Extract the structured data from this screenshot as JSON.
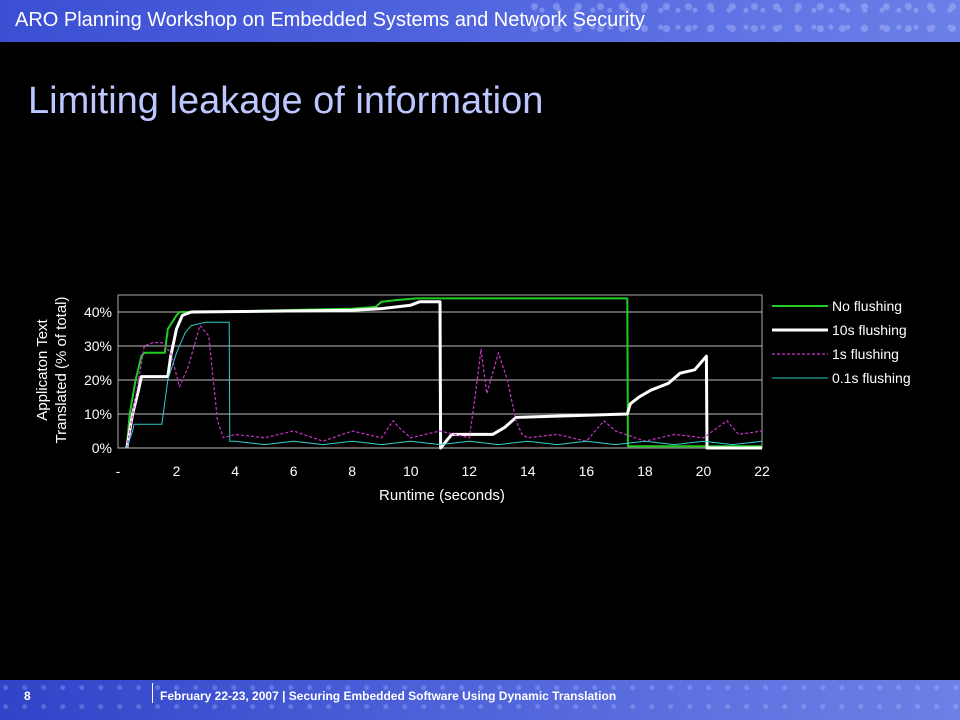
{
  "header": {
    "title": "ARO Planning Workshop on Embedded Systems and Network Security"
  },
  "slide": {
    "title": "Limiting leakage of information"
  },
  "footer": {
    "page_number": "8",
    "text": "February 22-23, 2007 | Securing Embedded Software Using Dynamic Translation"
  },
  "chart_data": {
    "type": "line",
    "title": "",
    "xlabel": "Runtime (seconds)",
    "ylabel_line1": "Applicaton Text",
    "ylabel_line2": "Translated (% of total)",
    "xlim": [
      0,
      22
    ],
    "ylim": [
      0,
      45
    ],
    "x_tick_labels": [
      "-",
      "2",
      "4",
      "6",
      "8",
      "10",
      "12",
      "14",
      "16",
      "18",
      "20",
      "22"
    ],
    "y_tick_labels": [
      "0%",
      "10%",
      "20%",
      "30%",
      "40%"
    ],
    "y_ticks": [
      0,
      10,
      20,
      30,
      40
    ],
    "grid": true,
    "legend_position": "right",
    "series": [
      {
        "name": "No flushing",
        "color": "#22cc22",
        "style": "solid",
        "width": 2,
        "x": [
          0.3,
          0.4,
          0.6,
          0.8,
          0.9,
          1.0,
          1.05,
          1.6,
          1.7,
          2.0,
          2.1,
          3.0,
          8.0,
          8.8,
          9.0,
          9.5,
          10.2,
          17.4,
          17.42,
          22.0
        ],
        "y": [
          0,
          10,
          20,
          27,
          28,
          28,
          28,
          28,
          35,
          39,
          40,
          40,
          41,
          41.5,
          43,
          43.5,
          44,
          44,
          0.5,
          0.5
        ]
      },
      {
        "name": "10s flushing",
        "color": "#ffffff",
        "style": "solid",
        "width": 3,
        "x": [
          0.3,
          0.5,
          0.7,
          0.8,
          1.7,
          1.8,
          2.0,
          2.2,
          2.5,
          8.0,
          9.0,
          10.0,
          10.3,
          11.0,
          11.02,
          11.4,
          12.8,
          13.2,
          13.6,
          17.4,
          17.5,
          17.8,
          18.2,
          18.8,
          19.2,
          19.7,
          20.1,
          20.12,
          22.0
        ],
        "y": [
          0,
          10,
          17,
          21,
          21,
          27,
          35,
          39,
          40,
          40.5,
          41,
          42,
          43,
          43,
          0,
          4,
          4,
          6,
          9,
          10,
          13,
          15,
          17,
          19,
          22,
          23,
          27,
          0,
          0
        ]
      },
      {
        "name": "1s flushing",
        "color": "#cc33cc",
        "style": "dashed",
        "width": 1.2,
        "x": [
          0.3,
          0.6,
          0.9,
          1.2,
          1.5,
          1.8,
          2.1,
          2.4,
          2.8,
          3.1,
          3.4,
          3.6,
          4.0,
          5.0,
          6.0,
          7.0,
          8.0,
          9.0,
          9.4,
          9.6,
          10.0,
          11.0,
          12.0,
          12.2,
          12.4,
          12.6,
          12.8,
          13.0,
          13.3,
          13.6,
          13.8,
          14.0,
          15.0,
          16.0,
          16.6,
          17.0,
          18.0,
          19.0,
          20.0,
          20.8,
          21.2,
          22.0
        ],
        "y": [
          0,
          15,
          30,
          31,
          31,
          28,
          18,
          24,
          36,
          33,
          8,
          3,
          4,
          3,
          5,
          2,
          5,
          3,
          8,
          6,
          3,
          5,
          3,
          15,
          29,
          16,
          22,
          28,
          20,
          8,
          4,
          3,
          4,
          2,
          8,
          5,
          2,
          4,
          3,
          8,
          4,
          5
        ]
      },
      {
        "name": "0.1s flushing",
        "color": "#33cccc",
        "style": "solid",
        "width": 1,
        "x": [
          0.3,
          0.5,
          0.55,
          0.6,
          0.7,
          1.0,
          1.5,
          1.7,
          2.0,
          2.3,
          2.5,
          3.0,
          3.8,
          3.82,
          4.0,
          5.0,
          6.0,
          7.0,
          8.0,
          9.0,
          10.0,
          11.0,
          12.0,
          13.0,
          14.0,
          15.0,
          16.0,
          17.0,
          18.0,
          19.0,
          20.0,
          21.0,
          22.0
        ],
        "y": [
          0,
          5,
          7,
          7,
          7,
          7,
          7,
          20,
          28,
          34,
          36,
          37,
          37,
          2,
          2,
          1,
          2,
          1,
          2,
          1,
          2,
          1,
          2,
          1,
          2,
          1,
          2,
          1,
          2,
          1,
          2,
          1,
          2
        ]
      }
    ]
  }
}
